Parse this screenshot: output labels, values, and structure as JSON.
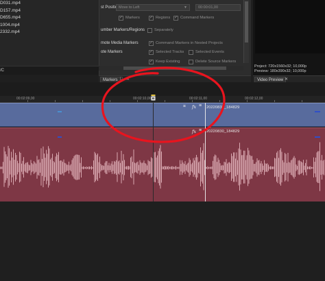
{
  "media": {
    "items": [
      "D031.mp4",
      "D157.mp4",
      "D655.mp4",
      "1004.mp4",
      "2332.mp4"
    ],
    "footer": "/C"
  },
  "markers_panel": {
    "paste_position_label": "st Position",
    "paste_position_value": "Move to Left",
    "paste_time_value": "00:00:01,00",
    "checkboxes_row1": [
      "Markers",
      "Regions",
      "Command Markers"
    ],
    "renumber_label": "umber Markers/Regions",
    "separately_label": "Separately",
    "promote_media_label": "mote Media Markers",
    "nested_label": "Command Markers in Nested Projects",
    "promote_label": "ote Markers",
    "selected_tracks_label": "Selected Tracks",
    "selected_events_label": "Selected Events",
    "keep_existing_label": "Keep Existing",
    "delete_source_label": "Delete Source Markers",
    "tab_label": "Markers"
  },
  "preview": {
    "project": "Project:  720x1560x32; 10,000p",
    "preview": "Preview:  180x390x32; 10,000p",
    "tab_label": "Video Preview"
  },
  "timeline": {
    "ruler_labels": [
      "00:02:09,00",
      "00:02:10,00",
      "00:02:11,00",
      "00:02:12,00"
    ],
    "video_clip_label": "20220830_184829",
    "audio_clip_label": "20220830_184829"
  },
  "colors": {
    "video_track": "#586b9d",
    "audio_track": "#7e3745",
    "annotation_circle": "#e8141e"
  }
}
